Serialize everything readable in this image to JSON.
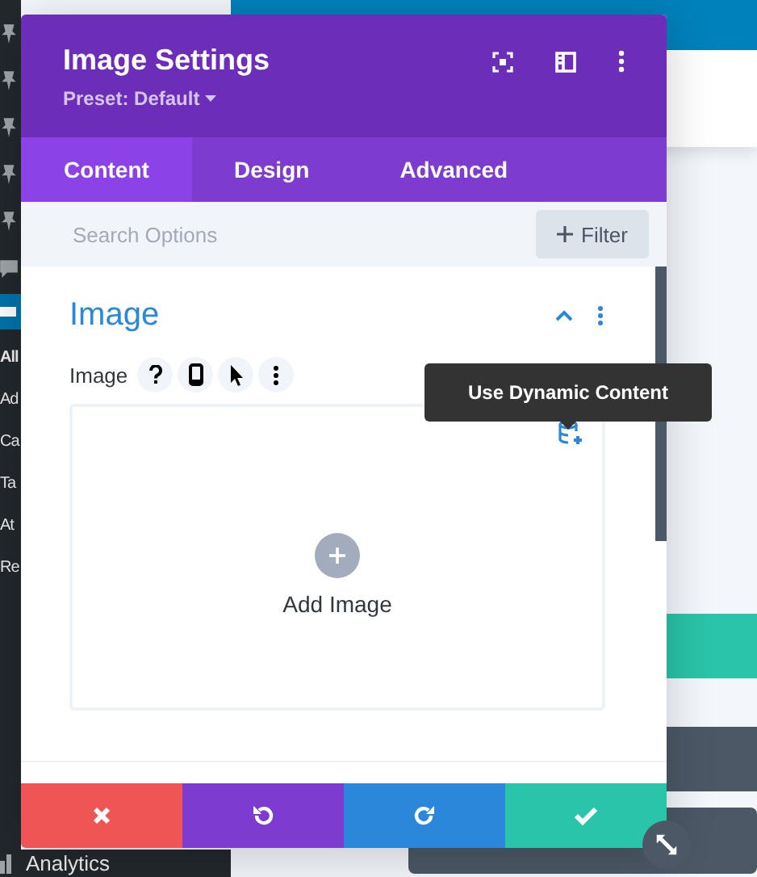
{
  "admin_menu": {
    "items": [
      "All",
      "Ad",
      "Ca",
      "Ta",
      "At",
      "Re"
    ],
    "bottom_item": "Analytics"
  },
  "modal": {
    "title": "Image Settings",
    "preset": "Preset: Default",
    "tabs": [
      {
        "label": "Content",
        "selected": true
      },
      {
        "label": "Design",
        "selected": false
      },
      {
        "label": "Advanced",
        "selected": false
      }
    ],
    "search": {
      "placeholder": "Search Options"
    },
    "filter_button": "Filter",
    "section": {
      "title": "Image",
      "expanded": true
    },
    "field": {
      "label": "Image"
    },
    "upload": {
      "label": "Add Image"
    },
    "tooltip": "Use Dynamic Content",
    "footer_buttons": [
      {
        "kind": "cancel"
      },
      {
        "kind": "undo"
      },
      {
        "kind": "redo"
      },
      {
        "kind": "save"
      }
    ]
  }
}
